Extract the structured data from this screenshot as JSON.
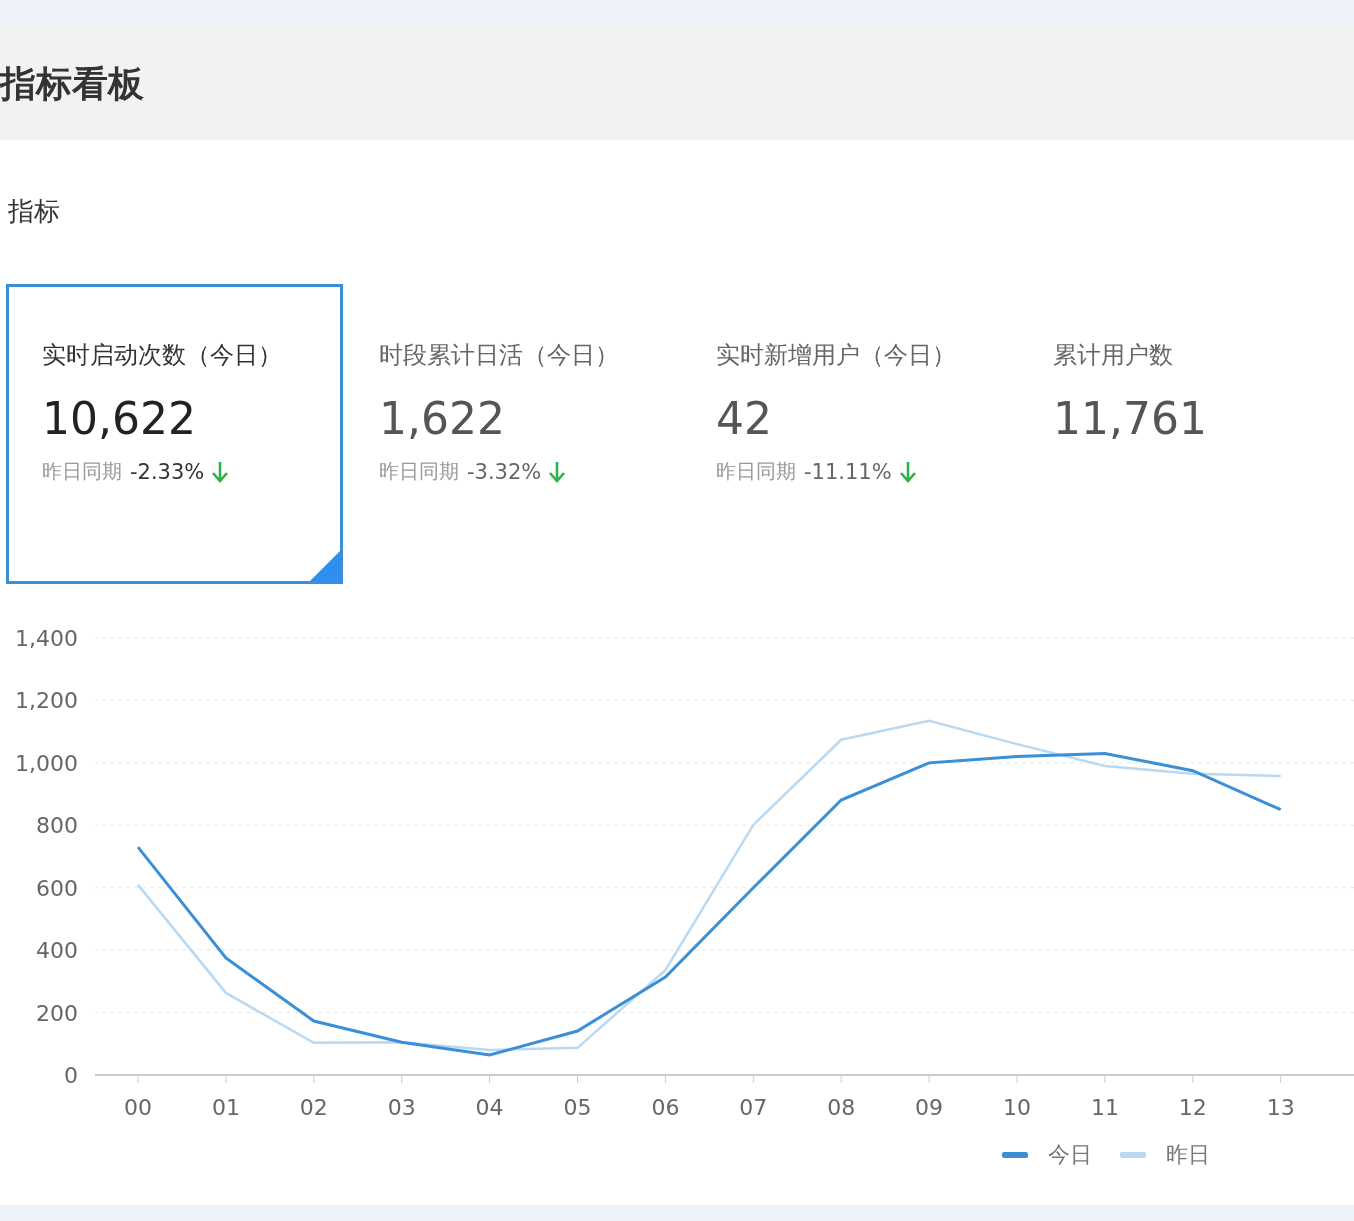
{
  "header": {
    "title": "指标看板"
  },
  "section": {
    "title": "指标"
  },
  "metrics": [
    {
      "label": "实时启动次数（今日）",
      "value": "10,622",
      "compare_label": "昨日同期",
      "change": "-2.33%",
      "kind": "down",
      "selected": true
    },
    {
      "label": "时段累计日活（今日）",
      "value": "1,622",
      "compare_label": "昨日同期",
      "change": "-3.32%",
      "kind": "down",
      "selected": false
    },
    {
      "label": "实时新增用户（今日）",
      "value": "42",
      "compare_label": "昨日同期",
      "change": "-11.11%",
      "kind": "down",
      "selected": false
    },
    {
      "label": "累计用户数",
      "value": "11,761",
      "selected": false
    }
  ],
  "chart": {
    "chart_data": {
      "type": "line",
      "categories": [
        "00",
        "01",
        "02",
        "03",
        "04",
        "05",
        "06",
        "07",
        "08",
        "09",
        "10",
        "11",
        "12",
        "13"
      ],
      "ylim": [
        0,
        1400
      ],
      "grid": true,
      "yticks": [
        {
          "value": 0,
          "label": "0"
        },
        {
          "value": 200,
          "label": "200"
        },
        {
          "value": 400,
          "label": "400"
        },
        {
          "value": 600,
          "label": "600"
        },
        {
          "value": 800,
          "label": "800"
        },
        {
          "value": 1000,
          "label": "1,000"
        },
        {
          "value": 1200,
          "label": "1,200"
        },
        {
          "value": 1400,
          "label": "1,400"
        }
      ],
      "series": [
        {
          "name": "今日",
          "color": "#3a8fd6",
          "values": [
            730,
            375,
            173,
            105,
            64,
            141,
            314,
            600,
            881,
            1000,
            1020,
            1030,
            975,
            850
          ]
        },
        {
          "name": "昨日",
          "color": "#b9d9f3",
          "values": [
            609,
            263,
            103,
            105,
            80,
            87,
            336,
            801,
            1074,
            1135,
            1060,
            990,
            965,
            958
          ]
        }
      ]
    }
  }
}
